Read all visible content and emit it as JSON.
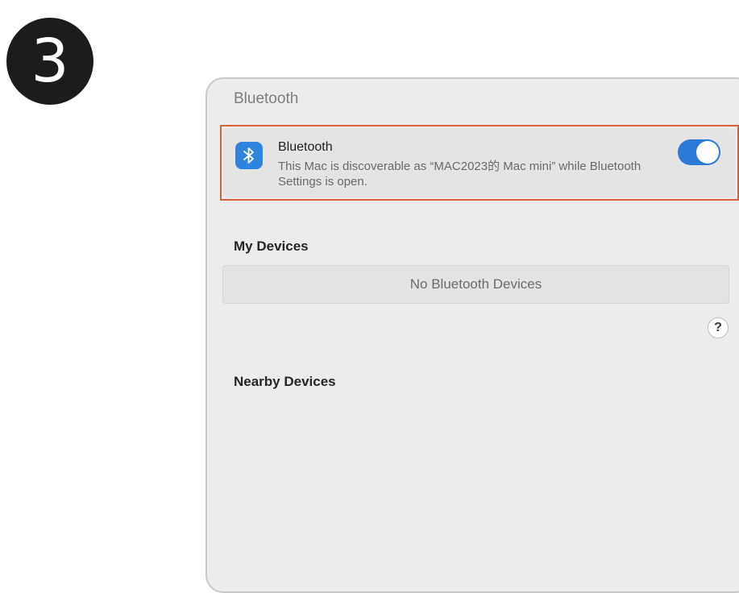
{
  "step": {
    "number": "3"
  },
  "window": {
    "title": "Bluetooth"
  },
  "bluetooth_row": {
    "name": "Bluetooth",
    "description": "This Mac is discoverable as “MAC2023的 Mac mini” while Bluetooth Settings is open.",
    "toggle_on": true,
    "icon": "bluetooth-icon"
  },
  "my_devices": {
    "heading": "My Devices",
    "empty_text": "No Bluetooth Devices"
  },
  "help": {
    "label": "?"
  },
  "nearby_devices": {
    "heading": "Nearby Devices"
  },
  "colors": {
    "accent": "#2c7ad6",
    "highlight_border": "#d9603a",
    "badge": "#1c1c1c"
  }
}
